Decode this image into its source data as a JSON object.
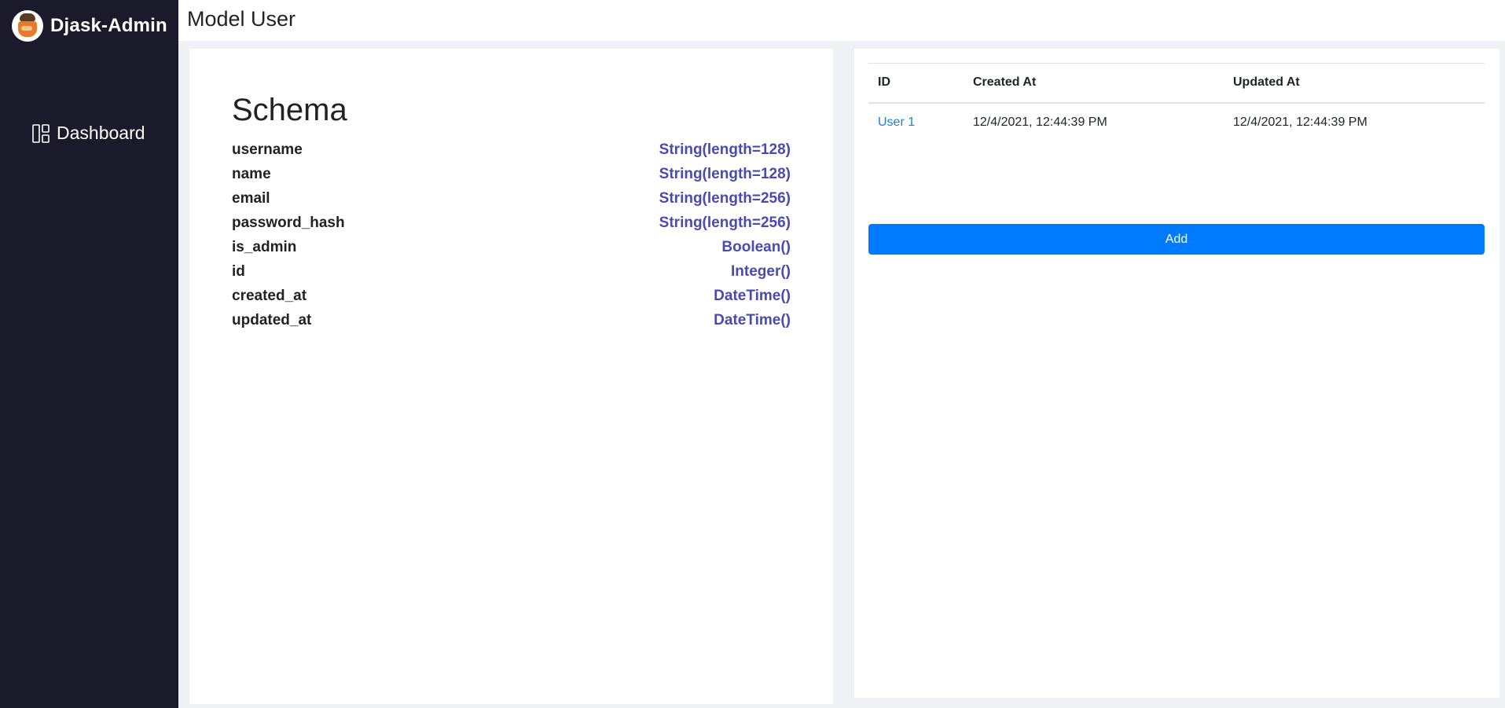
{
  "brand": {
    "name": "Djask-Admin",
    "logo_icon": "jar-logo-icon"
  },
  "sidebar": {
    "items": [
      {
        "label": "Dashboard",
        "icon": "dashboard-icon"
      }
    ]
  },
  "header": {
    "title": "Model User"
  },
  "schema": {
    "title": "Schema",
    "fields": [
      {
        "name": "username",
        "type": "String(length=128)"
      },
      {
        "name": "name",
        "type": "String(length=128)"
      },
      {
        "name": "email",
        "type": "String(length=256)"
      },
      {
        "name": "password_hash",
        "type": "String(length=256)"
      },
      {
        "name": "is_admin",
        "type": "Boolean()"
      },
      {
        "name": "id",
        "type": "Integer()"
      },
      {
        "name": "created_at",
        "type": "DateTime()"
      },
      {
        "name": "updated_at",
        "type": "DateTime()"
      }
    ]
  },
  "table": {
    "columns": [
      "ID",
      "Created At",
      "Updated At"
    ],
    "rows": [
      {
        "id": "User 1",
        "created_at": "12/4/2021, 12:44:39 PM",
        "updated_at": "12/4/2021, 12:44:39 PM"
      }
    ]
  },
  "add_button": {
    "label": "Add"
  },
  "colors": {
    "sidebar": "#1b1a2b",
    "accent": "#007bff",
    "type_text": "#4a4ab0",
    "link": "#1a7fe0"
  }
}
